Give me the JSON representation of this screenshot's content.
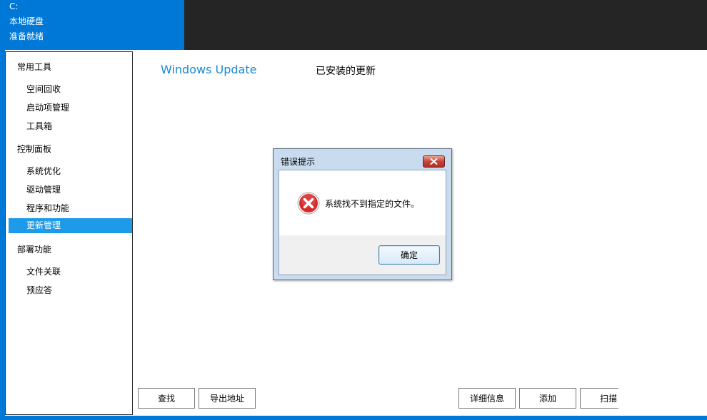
{
  "header": {
    "drive_letter": "C:",
    "drive_type": "本地硬盘",
    "status": "准备就绪"
  },
  "sidebar": {
    "groups": [
      {
        "label": "常用工具",
        "items": [
          "空间回收",
          "启动项管理",
          "工具箱"
        ]
      },
      {
        "label": "控制面板",
        "items": [
          "系统优化",
          "驱动管理",
          "程序和功能",
          "更新管理"
        ]
      },
      {
        "label": "部署功能",
        "items": [
          "文件关联",
          "预应答"
        ]
      }
    ],
    "active_item": "更新管理"
  },
  "main": {
    "title": "Windows Update",
    "subtitle": "已安装的更新",
    "buttons": {
      "find": "查找",
      "export": "导出地址",
      "details": "详细信息",
      "add": "添加",
      "scan": "扫描"
    }
  },
  "dialog": {
    "title": "错误提示",
    "message": "系统找不到指定的文件。",
    "ok_label": "确定",
    "icon": "error-icon"
  },
  "colors": {
    "accent": "#0078d7",
    "active_item": "#1e9be8",
    "title_blue": "#1a8ad4",
    "header_dark": "#252525"
  }
}
